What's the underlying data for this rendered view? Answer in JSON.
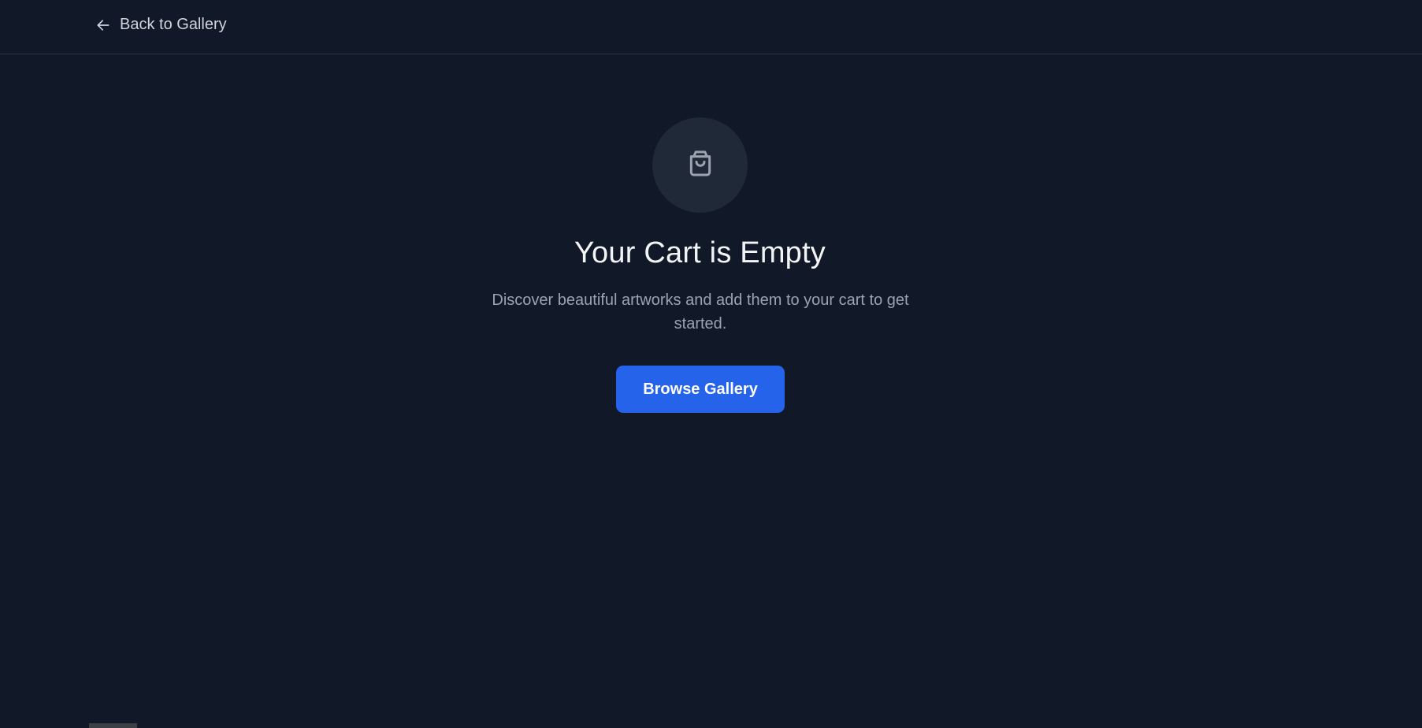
{
  "header": {
    "back_label": "Back to Gallery",
    "back_icon": "arrow-left-icon"
  },
  "empty_state": {
    "icon": "shopping-bag-icon",
    "title": "Your Cart is Empty",
    "description": "Discover beautiful artworks and add them to your cart to get started.",
    "cta_label": "Browse Gallery"
  },
  "colors": {
    "background": "#111827",
    "icon_circle": "#1f2937",
    "accent": "#2563eb",
    "title_text": "#f3f4f6",
    "muted_text": "#9ca3af"
  }
}
